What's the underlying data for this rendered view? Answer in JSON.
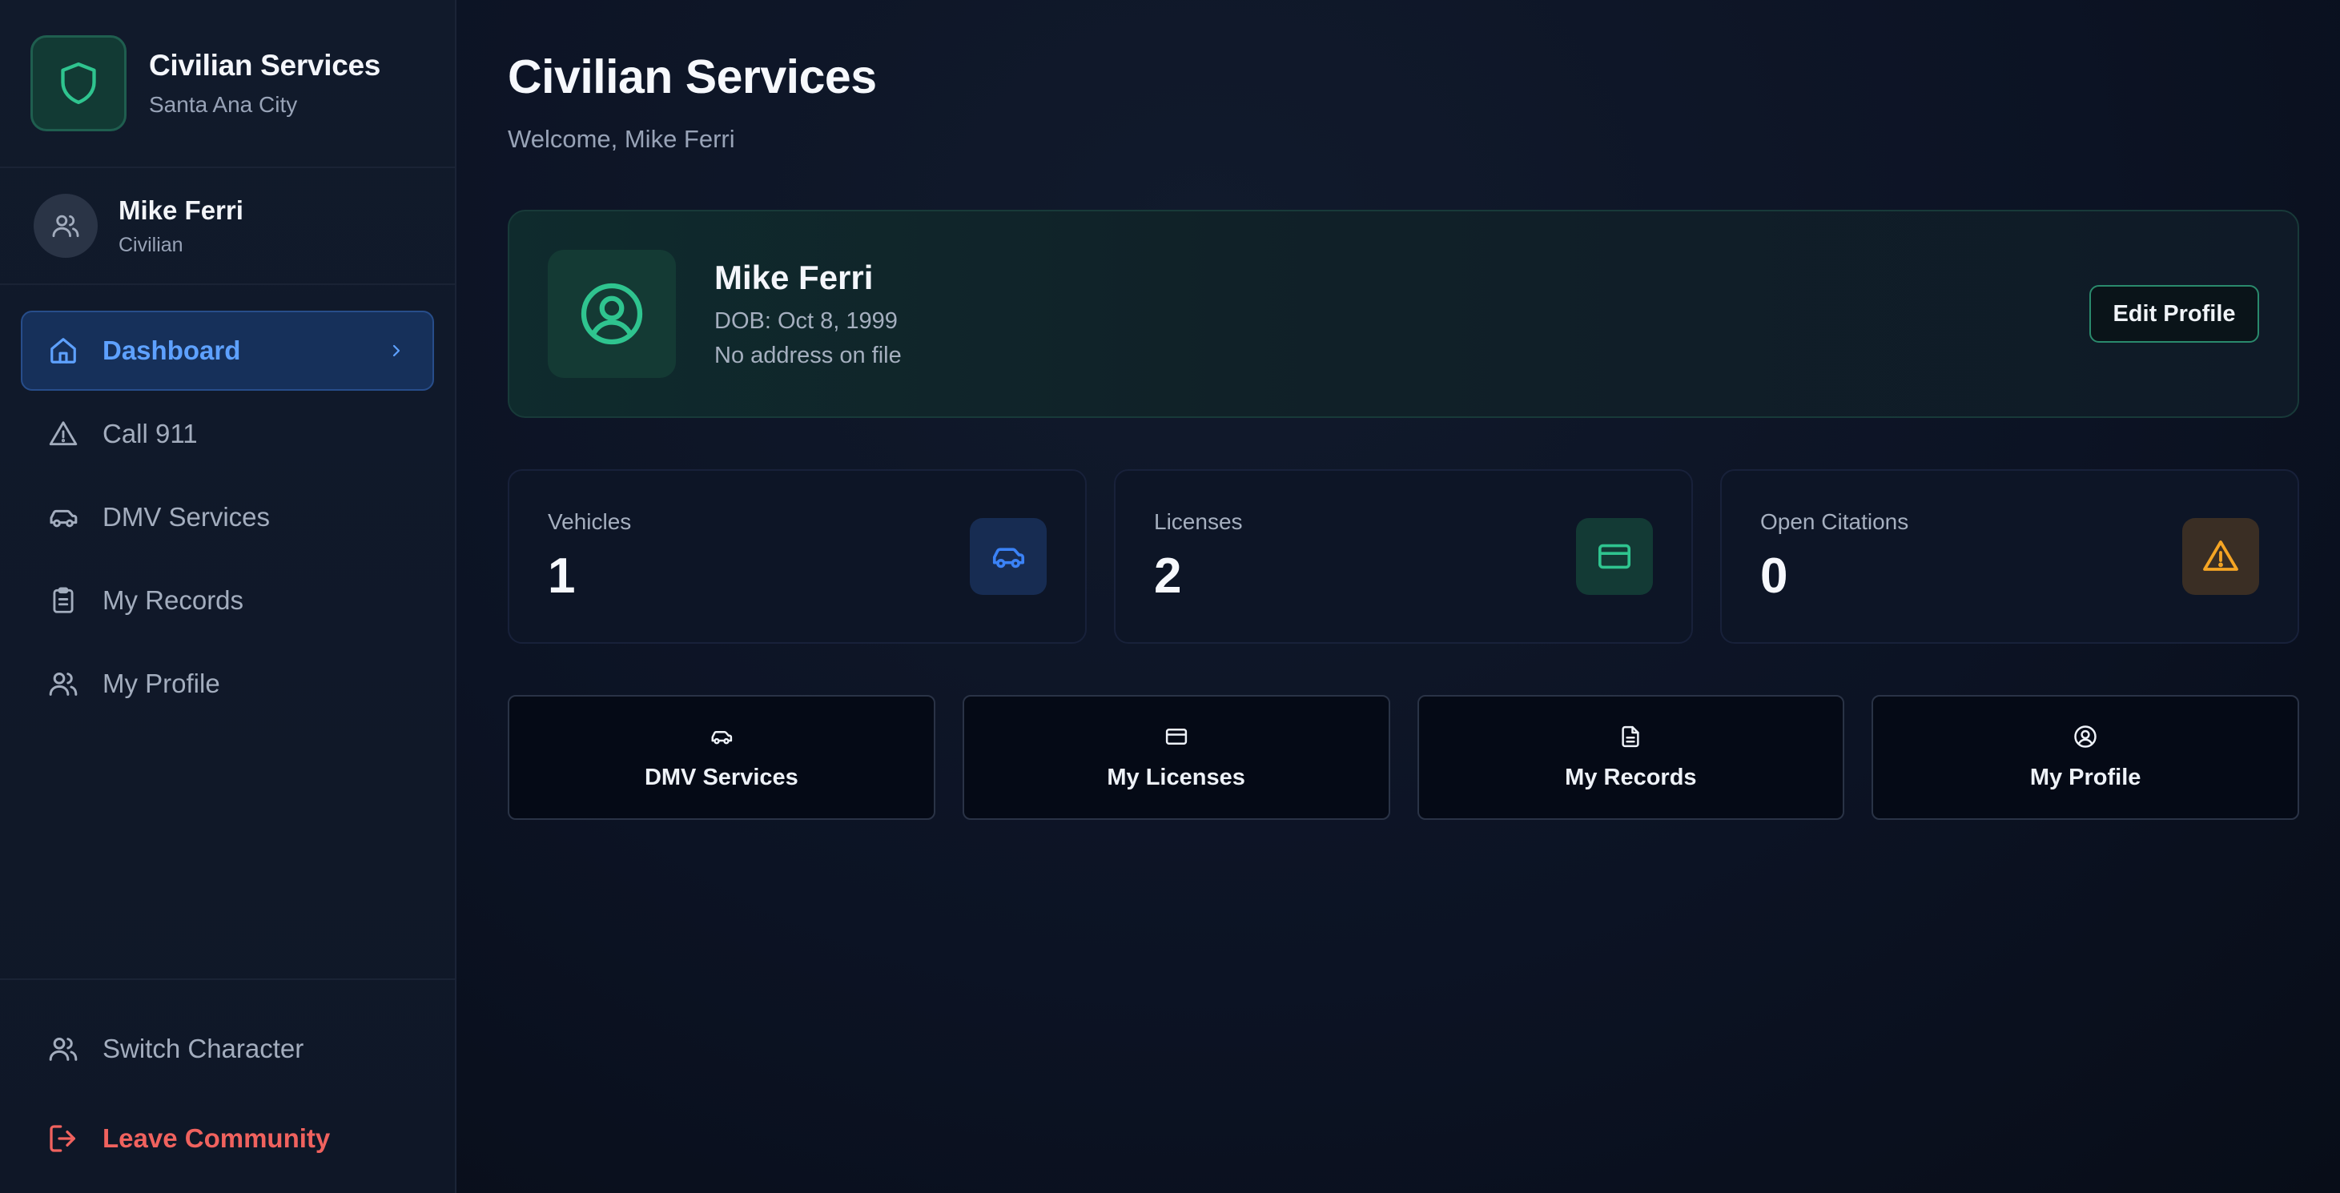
{
  "app": {
    "title": "Civilian Services",
    "subtitle": "Santa Ana City"
  },
  "user": {
    "name": "Mike Ferri",
    "role": "Civilian"
  },
  "nav": {
    "items": [
      {
        "label": "Dashboard",
        "icon": "home-icon",
        "active": true
      },
      {
        "label": "Call 911",
        "icon": "alert-triangle-icon"
      },
      {
        "label": "DMV Services",
        "icon": "car-icon"
      },
      {
        "label": "My Records",
        "icon": "clipboard-icon"
      },
      {
        "label": "My Profile",
        "icon": "users-icon"
      }
    ],
    "bottom": [
      {
        "label": "Switch Character",
        "icon": "users-icon"
      },
      {
        "label": "Leave Community",
        "icon": "logout-icon"
      }
    ]
  },
  "header": {
    "title": "Civilian Services",
    "welcome": "Welcome, Mike Ferri"
  },
  "profile": {
    "name": "Mike Ferri",
    "dob": "DOB: Oct 8, 1999",
    "address": "No address on file",
    "edit_label": "Edit Profile"
  },
  "stats": [
    {
      "label": "Vehicles",
      "value": "1",
      "icon": "car-icon",
      "color": "#3b82f6",
      "bg": "#172c52"
    },
    {
      "label": "Licenses",
      "value": "2",
      "icon": "credit-card-icon",
      "color": "#2fc48f",
      "bg": "#133a35"
    },
    {
      "label": "Open Citations",
      "value": "0",
      "icon": "alert-triangle-icon",
      "color": "#f5a524",
      "bg": "#3a2e24"
    }
  ],
  "quick_actions": [
    {
      "label": "DMV Services",
      "icon": "car-icon"
    },
    {
      "label": "My Licenses",
      "icon": "credit-card-icon"
    },
    {
      "label": "My Records",
      "icon": "file-text-icon"
    },
    {
      "label": "My Profile",
      "icon": "user-circle-icon"
    }
  ],
  "colors": {
    "accent_green": "#2fc48f",
    "accent_blue": "#5ea1ff",
    "danger": "#f0625e",
    "background": "#0a1020"
  }
}
